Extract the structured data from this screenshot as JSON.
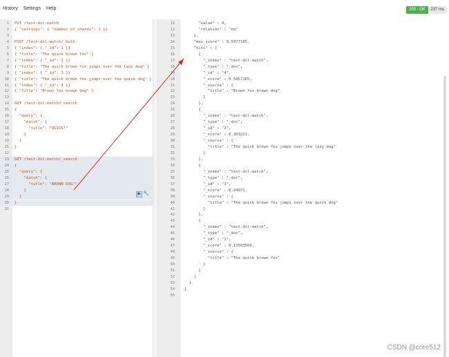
{
  "menu": {
    "items": [
      "History",
      "Settings",
      "Help"
    ]
  },
  "status": {
    "badge": "200 - OK",
    "time": "237 ms"
  },
  "request_lines": [
    {
      "n": "1",
      "t": "PUT /test-dsl-match"
    },
    {
      "n": "2",
      "t": "{ \"settings\": { \"number_of_shards\": 1 }}"
    },
    {
      "n": "3",
      "t": ""
    },
    {
      "n": "4",
      "t": "POST /test-dsl-match/_bulk"
    },
    {
      "n": "5",
      "t": "{ \"index\": { \"_id\": 1 }}"
    },
    {
      "n": "6",
      "t": "{ \"title\": \"The quick brown fox\" }"
    },
    {
      "n": "7",
      "t": "{ \"index\": { \"_id\": 2 }}"
    },
    {
      "n": "8",
      "t": "{ \"title\": \"The quick brown fox jumps over the lazy dog\" }"
    },
    {
      "n": "9",
      "t": "{ \"index\": { \"_id\": 3 }}"
    },
    {
      "n": "10",
      "t": "{ \"title\": \"The quick brown fox jumps over the quick dog\" }"
    },
    {
      "n": "11",
      "t": "{ \"index\": { \"_id\": 4 }}"
    },
    {
      "n": "12",
      "t": "{ \"title\": \"Brown fox brown dog\" }"
    },
    {
      "n": "13",
      "t": ""
    },
    {
      "n": "14",
      "t": "GET /test-dsl-match/_search"
    },
    {
      "n": "15",
      "t": "{"
    },
    {
      "n": "16",
      "t": "  \"query\": {"
    },
    {
      "n": "17",
      "t": "    \"match\": {"
    },
    {
      "n": "18",
      "t": "      \"title\": \"QUICK!\""
    },
    {
      "n": "19",
      "t": "    }"
    },
    {
      "n": "20",
      "t": "  }"
    },
    {
      "n": "21",
      "t": "}"
    },
    {
      "n": "22",
      "t": ""
    },
    {
      "n": "23",
      "t": "GET /test-dsl-match/_search"
    },
    {
      "n": "24",
      "t": "{"
    },
    {
      "n": "25",
      "t": "  \"query\": {"
    },
    {
      "n": "26",
      "t": "    \"match\": {"
    },
    {
      "n": "27",
      "t": "      \"title\": \"BROWN DOG!\""
    },
    {
      "n": "28",
      "t": "    }"
    },
    {
      "n": "29",
      "t": "  }"
    },
    {
      "n": "30",
      "t": "}"
    },
    {
      "n": "31",
      "t": ""
    }
  ],
  "response_lines": [
    {
      "n": "11",
      "t": "      \"value\" : 4,"
    },
    {
      "n": "12",
      "t": "      \"relation\" : \"eq\""
    },
    {
      "n": "13",
      "t": "    },"
    },
    {
      "n": "14",
      "t": "    \"max_score\" : 0.5077165,"
    },
    {
      "n": "15",
      "t": "    \"hits\" : ["
    },
    {
      "n": "16",
      "t": "      {"
    },
    {
      "n": "17",
      "t": "        \"_index\" : \"test-dsl-match\","
    },
    {
      "n": "18",
      "t": "        \"_type\" : \"_doc\","
    },
    {
      "n": "19",
      "t": "        \"_id\" : \"4\","
    },
    {
      "n": "20",
      "t": "        \"_score\" : 0.5857165,"
    },
    {
      "n": "21",
      "t": "        \"_source\" : {"
    },
    {
      "n": "22",
      "t": "          \"title\" : \"Brown fox brown dog\""
    },
    {
      "n": "23",
      "t": "        }"
    },
    {
      "n": "24",
      "t": "      },"
    },
    {
      "n": "25",
      "t": "      {"
    },
    {
      "n": "26",
      "t": "        \"_index\" : \"test-dsl-match\","
    },
    {
      "n": "27",
      "t": "        \"_type\" : \"_doc\","
    },
    {
      "n": "28",
      "t": "        \"_id\" : \"2\","
    },
    {
      "n": "29",
      "t": "        \"_score\" : 0.303221,"
    },
    {
      "n": "30",
      "t": "        \"_source\" : {"
    },
    {
      "n": "31",
      "t": "          \"title\" : \"The quick brown fox jumps over the lazy dog\""
    },
    {
      "n": "32",
      "t": "        }"
    },
    {
      "n": "33",
      "t": "      },"
    },
    {
      "n": "34",
      "t": "      {"
    },
    {
      "n": "35",
      "t": "        \"_index\" : \"test-dsl-match\","
    },
    {
      "n": "36",
      "t": "        \"_type\" : \"_doc\","
    },
    {
      "n": "37",
      "t": "        \"_id\" : \"3\","
    },
    {
      "n": "38",
      "t": "        \"_score\" : 0.24971,"
    },
    {
      "n": "39",
      "t": "        \"_source\" : {"
    },
    {
      "n": "40",
      "t": "          \"title\" : \"The quick brown fox jumps over the quick dog\""
    },
    {
      "n": "41",
      "t": "        }"
    },
    {
      "n": "42",
      "t": "      },"
    },
    {
      "n": "43",
      "t": "      {"
    },
    {
      "n": "44",
      "t": "        \"_index\" : \"test-dsl-match\","
    },
    {
      "n": "45",
      "t": "        \"_type\" : \"_doc\","
    },
    {
      "n": "46",
      "t": "        \"_id\" : \"1\","
    },
    {
      "n": "47",
      "t": "        \"_score\" : 0.12503565,"
    },
    {
      "n": "48",
      "t": "        \"_source\" : {"
    },
    {
      "n": "49",
      "t": "          \"title\" : \"The quick brown fox\""
    },
    {
      "n": "50",
      "t": "        }"
    },
    {
      "n": "51",
      "t": "      }"
    },
    {
      "n": "52",
      "t": "    ]"
    },
    {
      "n": "53",
      "t": "  }"
    },
    {
      "n": "54",
      "t": "}"
    },
    {
      "n": "55",
      "t": ""
    }
  ],
  "watermark": "CSDN @core512",
  "colors": {
    "status_ok": "#4caf50",
    "annotation_arrow": "#d62828",
    "selection": "#e4e9f0"
  }
}
